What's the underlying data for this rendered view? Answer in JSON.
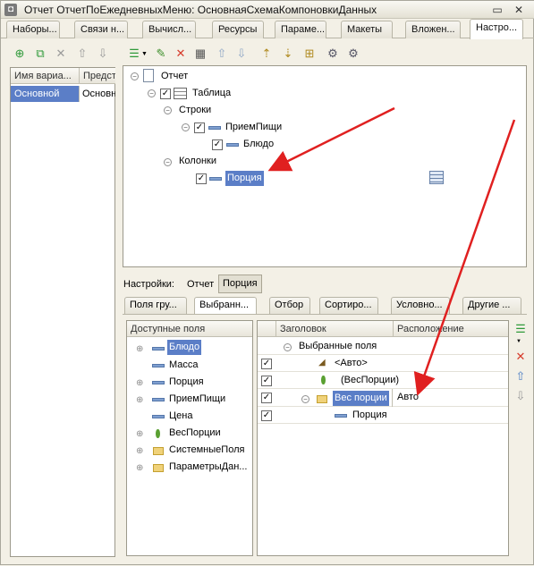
{
  "window": {
    "title": "Отчет ОтчетПоЕжедневныхМеню: ОсновнаяСхемаКомпоновкиДанных"
  },
  "tabs": [
    {
      "label": "Наборы..."
    },
    {
      "label": "Связи н..."
    },
    {
      "label": "Вычисл..."
    },
    {
      "label": "Ресурсы"
    },
    {
      "label": "Параме..."
    },
    {
      "label": "Макеты"
    },
    {
      "label": "Вложен..."
    },
    {
      "label": "Настро..."
    }
  ],
  "variants": {
    "col_name": "Имя вариа...",
    "col_repr": "Предста",
    "rows": [
      {
        "name": "Основной",
        "repr": "Основн"
      }
    ]
  },
  "structure": {
    "root": "Отчет",
    "table": "Таблица",
    "rows_group": "Строки",
    "rows_field1": "ПриемПищи",
    "rows_field2": "Блюдо",
    "cols_group": "Колонки",
    "cols_field": "Порция"
  },
  "settings_bar": {
    "label": "Настройки:",
    "btn_report": "Отчет",
    "btn_portion": "Порция"
  },
  "subtabs": [
    {
      "label": "Поля гру..."
    },
    {
      "label": "Выбранн..."
    },
    {
      "label": "Отбор"
    },
    {
      "label": "Сортиро..."
    },
    {
      "label": "Условно..."
    },
    {
      "label": "Другие ..."
    }
  ],
  "available_fields": {
    "header": "Доступные поля",
    "items": [
      {
        "label": "Блюдо"
      },
      {
        "label": "Масса"
      },
      {
        "label": "Порция"
      },
      {
        "label": "ПриемПищи"
      },
      {
        "label": "Цена"
      },
      {
        "label": "ВесПорции"
      },
      {
        "label": "СистемныеПоля"
      },
      {
        "label": "ПараметрыДан..."
      }
    ]
  },
  "selected_fields": {
    "col_title": "Заголовок",
    "col_placement": "Расположение",
    "root": "Выбранные поля",
    "rows": [
      {
        "label": "<Авто>",
        "placement": ""
      },
      {
        "label": "(ВесПорции)",
        "placement": ""
      },
      {
        "label": "Вес порции",
        "placement": "Авто"
      },
      {
        "label": "Порция",
        "placement": ""
      }
    ]
  },
  "colors": {
    "selection": "#5b7ec7",
    "arrow": "#e02020",
    "panel_bg": "#f3f0e6"
  }
}
